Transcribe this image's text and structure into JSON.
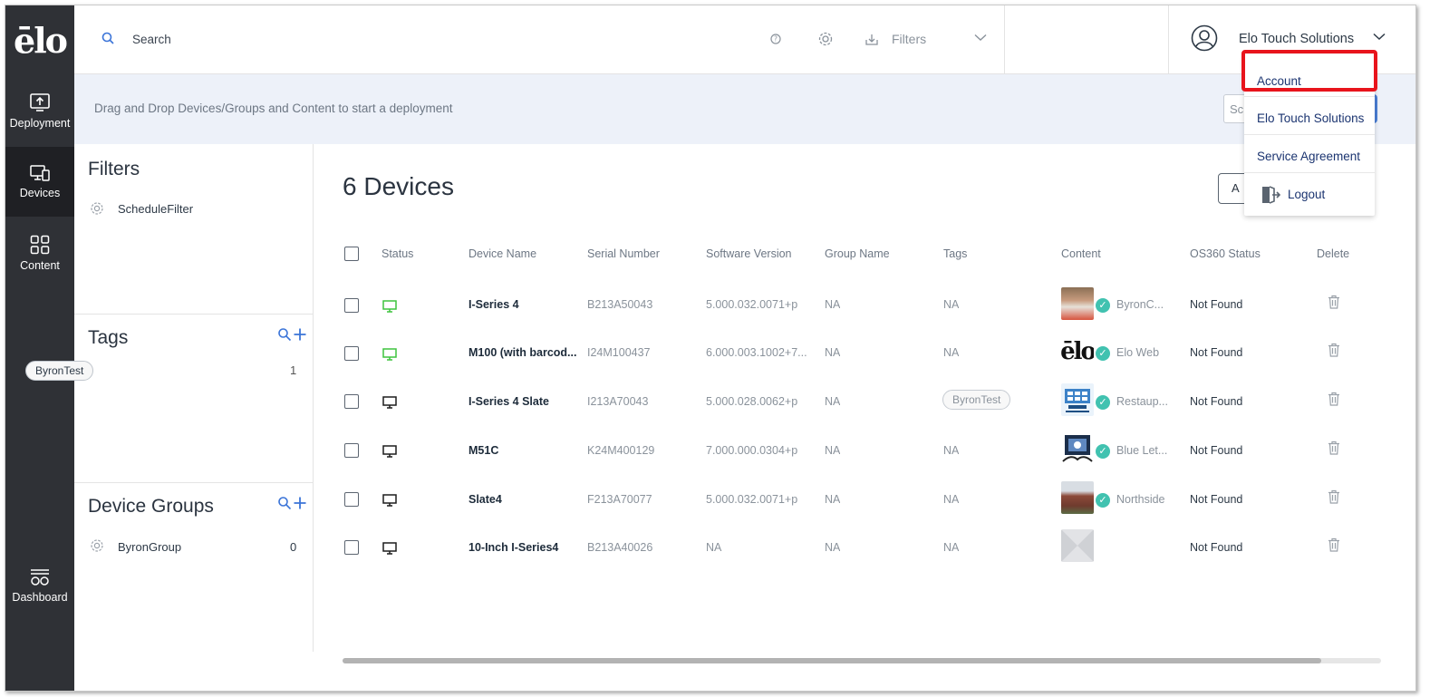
{
  "app": {
    "logo_text": "ēlo"
  },
  "nav": [
    {
      "label": "Deployment",
      "icon": "upload-icon"
    },
    {
      "label": "Devices",
      "icon": "devices-icon"
    },
    {
      "label": "Content",
      "icon": "grid-icon"
    },
    {
      "label": "Dashboard",
      "icon": "dashboard-icon"
    }
  ],
  "topbar": {
    "search_placeholder": "Search",
    "filters_label": "Filters",
    "user_name": "Elo Touch Solutions"
  },
  "banner": {
    "text": "Drag and Drop Devices/Groups and Content to start a deployment",
    "input_value": "Sc"
  },
  "filters": {
    "title": "Filters",
    "items": [
      "ScheduleFilter"
    ]
  },
  "tags": {
    "title": "Tags",
    "items": [
      {
        "label": "ByronTest",
        "count": "1"
      }
    ]
  },
  "groups": {
    "title": "Device Groups",
    "items": [
      {
        "label": "ByronGroup",
        "count": "0"
      }
    ]
  },
  "main": {
    "title": "6 Devices",
    "add_button_label": "A",
    "columns": [
      "Status",
      "Device Name",
      "Serial Number",
      "Software Version",
      "Group Name",
      "Tags",
      "Content",
      "OS360 Status",
      "Delete"
    ],
    "rows": [
      {
        "status": "online",
        "name": "I-Series 4",
        "serial": "B213A50043",
        "software": "5.000.032.0071+p",
        "group": "NA",
        "tags": "NA",
        "content": "ByronC...",
        "os360": "Not Found"
      },
      {
        "status": "online",
        "name": "M100 (with barcod...",
        "serial": "I24M100437",
        "software": "6.000.003.1002+7...",
        "group": "NA",
        "tags": "NA",
        "content": "Elo Web",
        "os360": "Not Found"
      },
      {
        "status": "offline",
        "name": "I-Series 4 Slate",
        "serial": "I213A70043",
        "software": "5.000.028.0062+p",
        "group": "NA",
        "tags": "ByronTest",
        "content": "Restaup...",
        "os360": "Not Found"
      },
      {
        "status": "offline",
        "name": "M51C",
        "serial": "K24M400129",
        "software": "7.000.000.0304+p",
        "group": "NA",
        "tags": "NA",
        "content": "Blue Let...",
        "os360": "Not Found"
      },
      {
        "status": "offline",
        "name": "Slate4",
        "serial": "F213A70077",
        "software": "5.000.032.0071+p",
        "group": "NA",
        "tags": "NA",
        "content": "Northside",
        "os360": "Not Found"
      },
      {
        "status": "offline",
        "name": "10-Inch I-Series4",
        "serial": "B213A40026",
        "software": "NA",
        "group": "NA",
        "tags": "NA",
        "content": "",
        "os360": "Not Found"
      }
    ]
  },
  "dropdown": {
    "items": [
      "Account",
      "Elo Touch Solutions",
      "Service Agreement",
      "Logout"
    ],
    "highlighted": "Account"
  },
  "colors": {
    "online": "#3ec43e",
    "offline": "#1d1d1d",
    "accent": "#4a7fd6",
    "highlight": "#e8141c",
    "nav_bg": "#2f3136"
  }
}
